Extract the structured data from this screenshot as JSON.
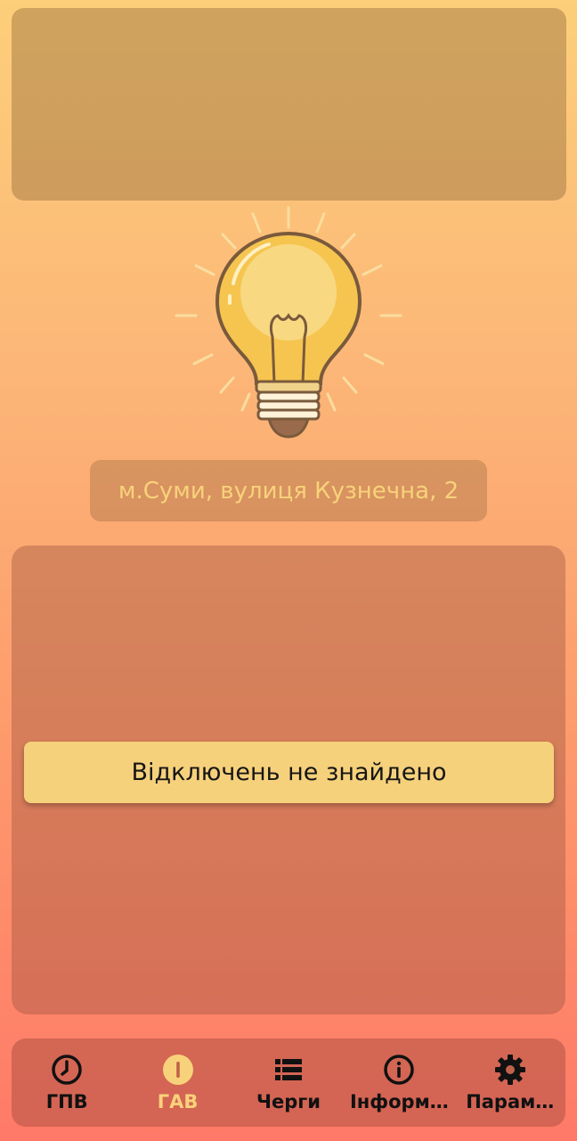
{
  "address": {
    "text": "м.Суми, вулиця Кузнечна, 2"
  },
  "status": {
    "message": "Відключень не знайдено"
  },
  "colors": {
    "accent": "#f8d27a",
    "card": "#f6d17b",
    "bulb": "#f7c85a"
  },
  "nav": {
    "active": "gav",
    "items": [
      {
        "id": "gpv",
        "label": "ГПВ",
        "icon": "clock-icon"
      },
      {
        "id": "gav",
        "label": "ГАВ",
        "icon": "lightning-circle-icon"
      },
      {
        "id": "queues",
        "label": "Черги",
        "icon": "list-icon"
      },
      {
        "id": "info",
        "label": "Інформ…",
        "icon": "info-icon"
      },
      {
        "id": "settings",
        "label": "Парам…",
        "icon": "gear-icon"
      }
    ]
  }
}
